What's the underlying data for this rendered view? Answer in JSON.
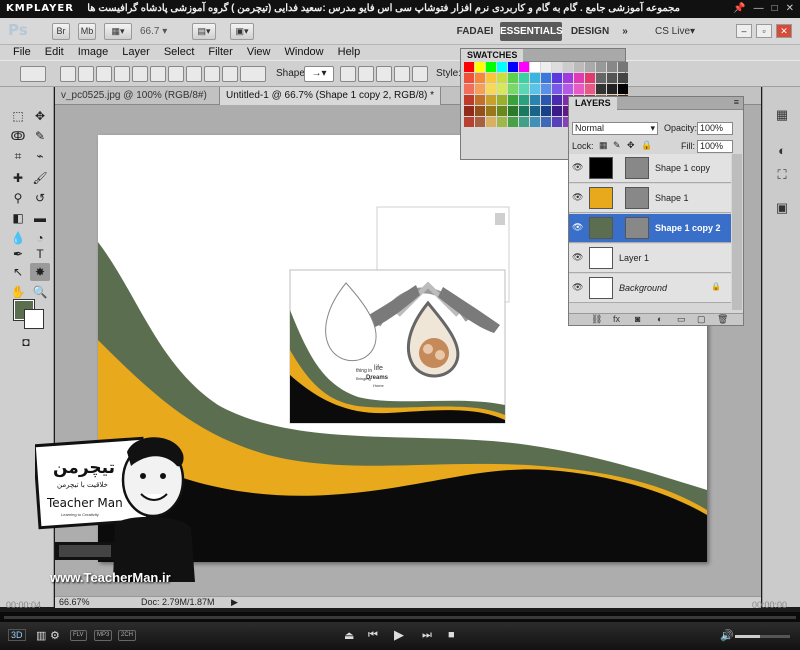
{
  "player": {
    "logo": "KMPLAYER",
    "caption": "مجموعه آموزشی جامع . گام به گام و کاربردی نرم افزار فتوشاپ سی اس فایو  مدرس :سعید فدایی (تیچرمن ) گروه آموزشی پادشاه گرافیست ها",
    "time_left": "00:00:04",
    "time_right": "00:00:00",
    "badges": [
      "FLV",
      "MP3",
      "2CH"
    ],
    "volume_level": 0.45,
    "controls": {
      "eject": "⏏",
      "prev": "⏮",
      "play": "▶",
      "next": "⏭",
      "stop": "■",
      "three_d": "3D"
    }
  },
  "appbar": {
    "logo": "Ps",
    "br": "Br",
    "mb": "Mb",
    "zoom": "66.7",
    "workspaces": [
      "FADAEI",
      "ESSENTIALS",
      "DESIGN"
    ],
    "active_workspace": "ESSENTIALS",
    "more": "»",
    "cslive": "CS Live▾"
  },
  "menu": [
    "File",
    "Edit",
    "Image",
    "Layer",
    "Select",
    "Filter",
    "View",
    "Window",
    "Help"
  ],
  "options": {
    "shape_label": "Shape:",
    "style_label": "Style:"
  },
  "tabs": [
    {
      "label": "v_pc0525.jpg @ 100% (RGB/8#)"
    },
    {
      "label": "Untitled-1 @ 66.7% (Shape 1 copy 2, RGB/8) *"
    }
  ],
  "status": {
    "zoom": "66.67%",
    "doc": "Doc: 2.79M/1.87M"
  },
  "canvas_design": {
    "brochure_text_1": "thing in",
    "brochure_text_2": "life",
    "brochure_text_3": "Bringing",
    "brochure_text_4": "Dreams",
    "brochure_text_5": "Home"
  },
  "swatches": {
    "title": "SWATCHES",
    "colors": [
      "#ff0000",
      "#ffff00",
      "#00ff00",
      "#00ffff",
      "#0000ff",
      "#ff00ff",
      "#ffffff",
      "#eeeeee",
      "#dddddd",
      "#cccccc",
      "#bbbbbb",
      "#aaaaaa",
      "#999999",
      "#888888",
      "#777777",
      "#f0503a",
      "#f5883a",
      "#f8c83a",
      "#c8e03a",
      "#5ad24a",
      "#3ad2a0",
      "#3ab4e0",
      "#3a78e0",
      "#5a3ae0",
      "#a03ae0",
      "#e03ab4",
      "#e03a6e",
      "#666666",
      "#555555",
      "#444444",
      "#f06e5a",
      "#f5a05a",
      "#f8d85a",
      "#d8e85a",
      "#7ad86a",
      "#5ad8b4",
      "#5ac4e8",
      "#5a90e8",
      "#785ae8",
      "#b45ae8",
      "#e85ac4",
      "#e85a86",
      "#333333",
      "#222222",
      "#000000",
      "#c03a2a",
      "#c5702a",
      "#c8a02a",
      "#98b02a",
      "#3aa23a",
      "#2aa280",
      "#2a84b0",
      "#2a58b0",
      "#4a2ab0",
      "#802ab0",
      "#b02a84",
      "#b02a4e",
      "#8a6a4a",
      "#6a4a2a",
      "#4a2a0a",
      "#902a1a",
      "#95501a",
      "#98781a",
      "#688a1a",
      "#2a7a2a",
      "#1a7a60",
      "#1a6488",
      "#1a4088",
      "#3a1a88",
      "#601a88",
      "#881a64",
      "#881a3a",
      "#b89a7a",
      "#9a7a5a",
      "#7a5a3a",
      "#b84030",
      "#a86040",
      "#d8b060",
      "#a0b848",
      "#48a048",
      "#40a088",
      "#4090b8",
      "#4068b8",
      "#5840b8",
      "#8840b8",
      "#b84090",
      "#b84060",
      "#c0a890",
      "#a89070",
      "#907050"
    ]
  },
  "layers": {
    "title": "LAYERS",
    "blend_mode": "Normal",
    "opacity_label": "Opacity:",
    "opacity": "100%",
    "lock_label": "Lock:",
    "fill_label": "Fill:",
    "fill": "100%",
    "items": [
      {
        "name": "Shape 1 copy",
        "thumb_color": "#000000",
        "selected": false
      },
      {
        "name": "Shape 1",
        "thumb_color": "#e8a91d",
        "selected": false
      },
      {
        "name": "Shape 1 copy 2",
        "thumb_color": "#5c6e50",
        "selected": true
      },
      {
        "name": "Layer 1",
        "thumb_color": "#ffffff",
        "selected": false
      },
      {
        "name": "Background",
        "thumb_color": "#ffffff",
        "selected": false
      }
    ]
  },
  "watermark": {
    "brand_fa": "تیچرمن",
    "brand_sub_fa": "خلاقیت با تیچرمن",
    "brand_en": "Teacher Man",
    "tag": "Learning to Creativity",
    "url": "www.TeacherMan.ir"
  },
  "colors": {
    "olive": "#5c6e50",
    "gold": "#e8a91d",
    "black": "#000000",
    "selection_blue": "#3a6fc9"
  }
}
